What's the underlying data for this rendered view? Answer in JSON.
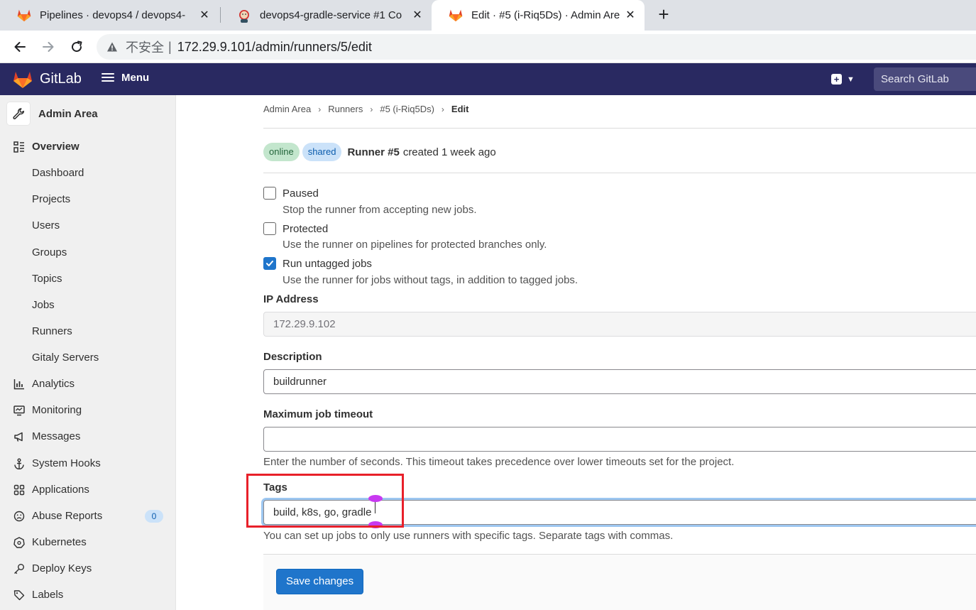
{
  "browser": {
    "tabs": [
      {
        "title": "Pipelines · devops4 / devops4-",
        "icon": "gitlab-icon",
        "active": false
      },
      {
        "title": "devops4-gradle-service #1 Co",
        "icon": "jenkins-icon",
        "active": false
      },
      {
        "title": "Edit · #5 (i-Riq5Ds) · Admin Are",
        "icon": "gitlab-icon",
        "active": true
      }
    ],
    "address": {
      "security_label": "不安全",
      "separator": "|",
      "url": "172.29.9.101/admin/runners/5/edit"
    }
  },
  "topnav": {
    "brand": "GitLab",
    "menu_label": "Menu",
    "search_placeholder": "Search GitLab",
    "brand_color": "#292961"
  },
  "sidebar": {
    "title": "Admin Area",
    "items": [
      {
        "label": "Overview",
        "icon": "overview-icon",
        "section": true
      },
      {
        "label": "Dashboard"
      },
      {
        "label": "Projects"
      },
      {
        "label": "Users"
      },
      {
        "label": "Groups"
      },
      {
        "label": "Topics"
      },
      {
        "label": "Jobs"
      },
      {
        "label": "Runners"
      },
      {
        "label": "Gitaly Servers"
      },
      {
        "label": "Analytics",
        "icon": "chart-icon",
        "section": true
      },
      {
        "label": "Monitoring",
        "icon": "monitor-icon",
        "section": true
      },
      {
        "label": "Messages",
        "icon": "megaphone-icon",
        "section": true
      },
      {
        "label": "System Hooks",
        "icon": "anchor-icon",
        "section": true
      },
      {
        "label": "Applications",
        "icon": "grid-icon",
        "section": true
      },
      {
        "label": "Abuse Reports",
        "icon": "sad-face-icon",
        "section": true,
        "badge": "0"
      },
      {
        "label": "Kubernetes",
        "icon": "kubernetes-icon",
        "section": true
      },
      {
        "label": "Deploy Keys",
        "icon": "key-icon",
        "section": true
      },
      {
        "label": "Labels",
        "icon": "label-icon",
        "section": true
      }
    ]
  },
  "breadcrumb": {
    "items": [
      "Admin Area",
      "Runners",
      "#5 (i-Riq5Ds)"
    ],
    "current": "Edit"
  },
  "runner": {
    "status_badge": "online",
    "type_badge": "shared",
    "name": "Runner #5",
    "created": "created 1 week ago"
  },
  "form": {
    "paused": {
      "label": "Paused",
      "help": "Stop the runner from accepting new jobs.",
      "checked": false
    },
    "protected": {
      "label": "Protected",
      "help": "Use the runner on pipelines for protected branches only.",
      "checked": false
    },
    "run_untagged": {
      "label": "Run untagged jobs",
      "help": "Use the runner for jobs without tags, in addition to tagged jobs.",
      "checked": true
    },
    "ip_address": {
      "label": "IP Address",
      "value": "172.29.9.102"
    },
    "description": {
      "label": "Description",
      "value": "buildrunner"
    },
    "timeout": {
      "label": "Maximum job timeout",
      "value": "",
      "help": "Enter the number of seconds. This timeout takes precedence over lower timeouts set for the project."
    },
    "tags": {
      "label": "Tags",
      "value": "build, k8s, go, gradle",
      "help": "You can set up jobs to only use runners with specific tags. Separate tags with commas."
    },
    "save_label": "Save changes"
  },
  "annotation": {
    "highlight_color": "#e8202a"
  }
}
